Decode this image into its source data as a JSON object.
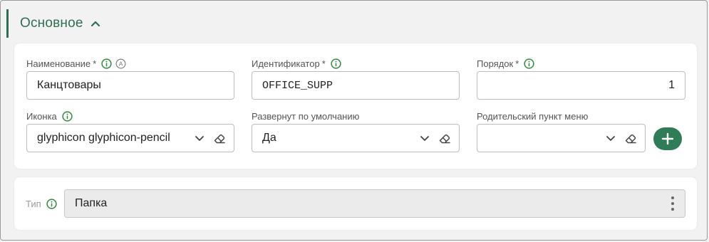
{
  "section": {
    "title": "Основное"
  },
  "fields": {
    "name": {
      "label": "Наименование",
      "required": "*",
      "value": "Канцтовары"
    },
    "identifier": {
      "label": "Идентификатор",
      "required": "*",
      "value": "OFFICE_SUPP"
    },
    "order": {
      "label": "Порядок",
      "required": "*",
      "value": "1"
    },
    "icon": {
      "label": "Иконка",
      "value": "glyphicon glyphicon-pencil"
    },
    "expanded": {
      "label": "Развернут по умолчанию",
      "value": "Да"
    },
    "parent": {
      "label": "Родительский пункт меню",
      "value": ""
    },
    "type": {
      "label": "Тип",
      "value": "Папка"
    }
  },
  "icons": {
    "info": "info-icon",
    "auto": "auto-a-icon",
    "chevron": "chevron-down-icon",
    "eraser": "eraser-icon",
    "add": "plus-icon",
    "kebab": "kebab-menu-icon"
  },
  "colors": {
    "accent": "#2e6e52",
    "button": "#2e7d56",
    "info": "#2f8a3e"
  }
}
